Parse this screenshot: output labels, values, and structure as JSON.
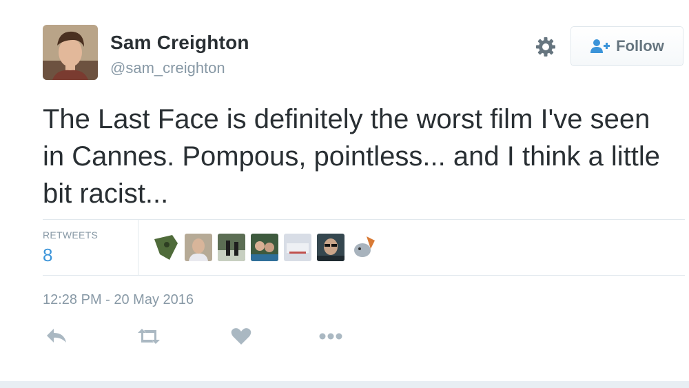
{
  "author": {
    "name": "Sam Creighton",
    "handle": "@sam_creighton"
  },
  "follow_button": {
    "label": "Follow"
  },
  "tweet": {
    "text": "The Last Face is definitely the worst film I've seen in Cannes. Pompous, pointless... and I think a little bit racist..."
  },
  "stats": {
    "retweets_label": "RETWEETS",
    "retweets_count": "8"
  },
  "timestamp": "12:28 PM - 20 May 2016",
  "icons": {
    "settings": "gear-icon",
    "follow": "person-add-icon",
    "reply": "reply-icon",
    "retweet": "retweet-icon",
    "like": "heart-icon",
    "more": "more-dots-icon"
  },
  "colors": {
    "text": "#292f33",
    "muted": "#8899a6",
    "link": "#3b94d9",
    "border": "#e1e8ed",
    "icon": "#aab8c2"
  }
}
